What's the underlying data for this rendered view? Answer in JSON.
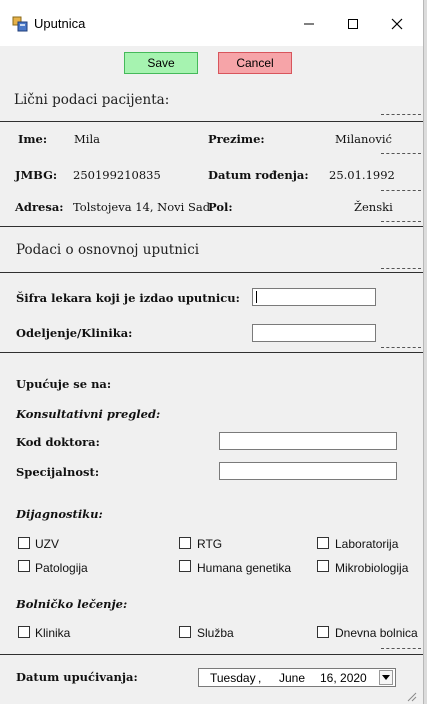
{
  "window": {
    "title": "Uputnica"
  },
  "toolbar": {
    "save_label": "Save",
    "cancel_label": "Cancel"
  },
  "personal": {
    "section_title": "Lični podaci pacijenta:",
    "ime_label": "Ime:",
    "ime_value": "Mila",
    "prezime_label": "Prezime:",
    "prezime_value": "Milanović",
    "jmbg_label": "JMBG:",
    "jmbg_value": "250199210835",
    "datum_label": "Datum rođenja:",
    "datum_value": "25.01.1992",
    "adresa_label": "Adresa:",
    "adresa_value": "Tolstojeva 14, Novi Sad",
    "pol_label": "Pol:",
    "pol_value": "Ženski"
  },
  "referral": {
    "section_title": "Podaci o osnovnoj uputnici",
    "sifra_label": "Šifra lekara koji je izdao uputnicu:",
    "sifra_value": "",
    "odeljenje_label": "Odeljenje/Klinika:",
    "odeljenje_value": ""
  },
  "upucuje": {
    "heading": "Upućuje se na:",
    "konsultativni": "Konsultativni pregled:",
    "kod_label": "Kod doktora:",
    "kod_value": "",
    "spec_label": "Specijalnost:",
    "spec_value": "",
    "dijagnostiku": "Dijagnostiku:",
    "diag_items": [
      "UZV",
      "RTG",
      "Laboratorija",
      "Patologija",
      "Humana genetika",
      "Mikrobiologija"
    ],
    "bolnicko": "Bolničko lečenje:",
    "hosp_items": [
      "Klinika",
      "Služba",
      "Dnevna bolnica"
    ]
  },
  "footer": {
    "datum_label": "Datum upućivanja:",
    "date_weekday": "Tuesday",
    "date_sep": ",",
    "date_month": "June",
    "date_day_year": "16, 2020"
  }
}
